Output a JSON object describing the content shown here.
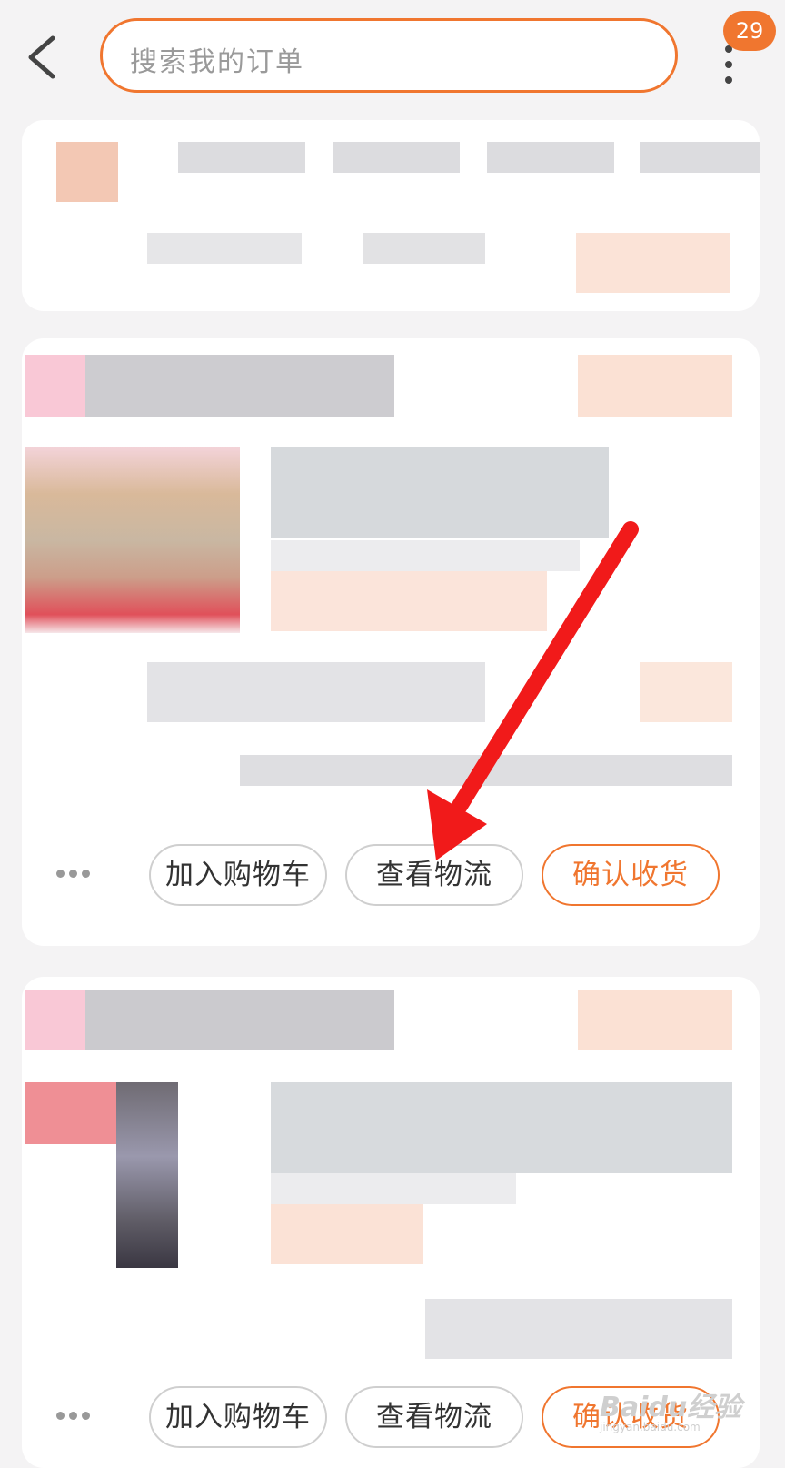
{
  "search": {
    "placeholder": "搜索我的订单"
  },
  "notifications": {
    "count": "29"
  },
  "order_cards": [
    {
      "actions": [
        "加入购物车",
        "查看物流",
        "确认收货"
      ]
    },
    {
      "actions": [
        "加入购物车",
        "查看物流",
        "确认收货"
      ]
    }
  ],
  "watermark": {
    "text": "Baidu经验",
    "sub": "jingyan.baidu.com"
  },
  "colors": {
    "accent": "#f0762f",
    "arrow": "#f11a1a",
    "background": "#f4f3f4"
  }
}
